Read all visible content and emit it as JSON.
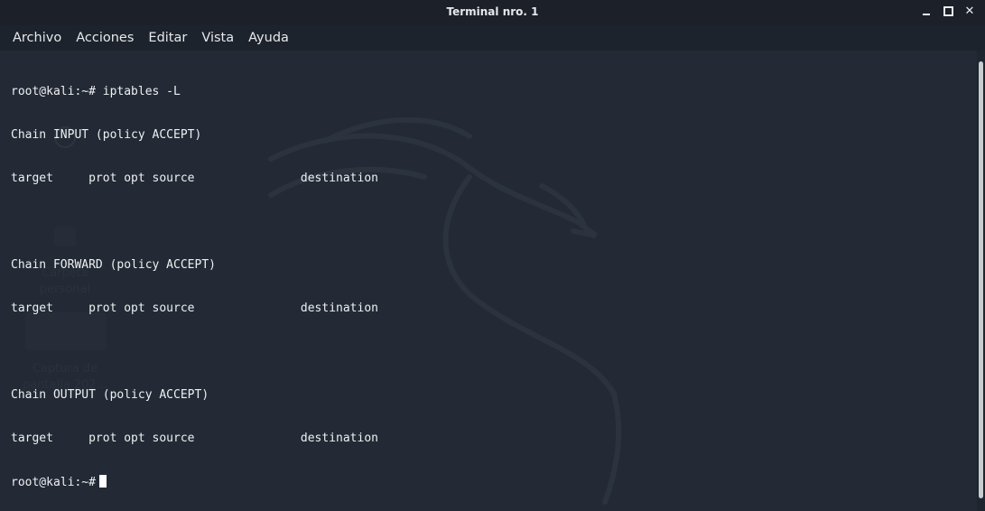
{
  "window": {
    "title": "Terminal nro. 1",
    "controls": {
      "minimize": "minimize",
      "maximize": "maximize",
      "close": "✕"
    }
  },
  "menu": {
    "items": [
      {
        "label": "Archivo"
      },
      {
        "label": "Acciones"
      },
      {
        "label": "Editar"
      },
      {
        "label": "Vista"
      },
      {
        "label": "Ayuda"
      }
    ]
  },
  "terminal": {
    "lines": [
      "root@kali:~# iptables -L",
      "Chain INPUT (policy ACCEPT)",
      "target     prot opt source               destination",
      "",
      "Chain FORWARD (policy ACCEPT)",
      "target     prot opt source               destination",
      "",
      "Chain OUTPUT (policy ACCEPT)",
      "target     prot opt source               destination"
    ],
    "prompt": "root@kali:~#"
  },
  "desktop_background": {
    "icons": [
      {
        "label_line1": "Carpeta",
        "label_line2": "personal"
      },
      {
        "label_line1": "Captura de",
        "label_line2": "pantalla 202..."
      }
    ]
  },
  "colors": {
    "background": "#232a35",
    "titlebar": "#1b2029",
    "menubar": "#1d232c",
    "text": "#eef0f2",
    "dragon_watermark": "#2b333f"
  }
}
